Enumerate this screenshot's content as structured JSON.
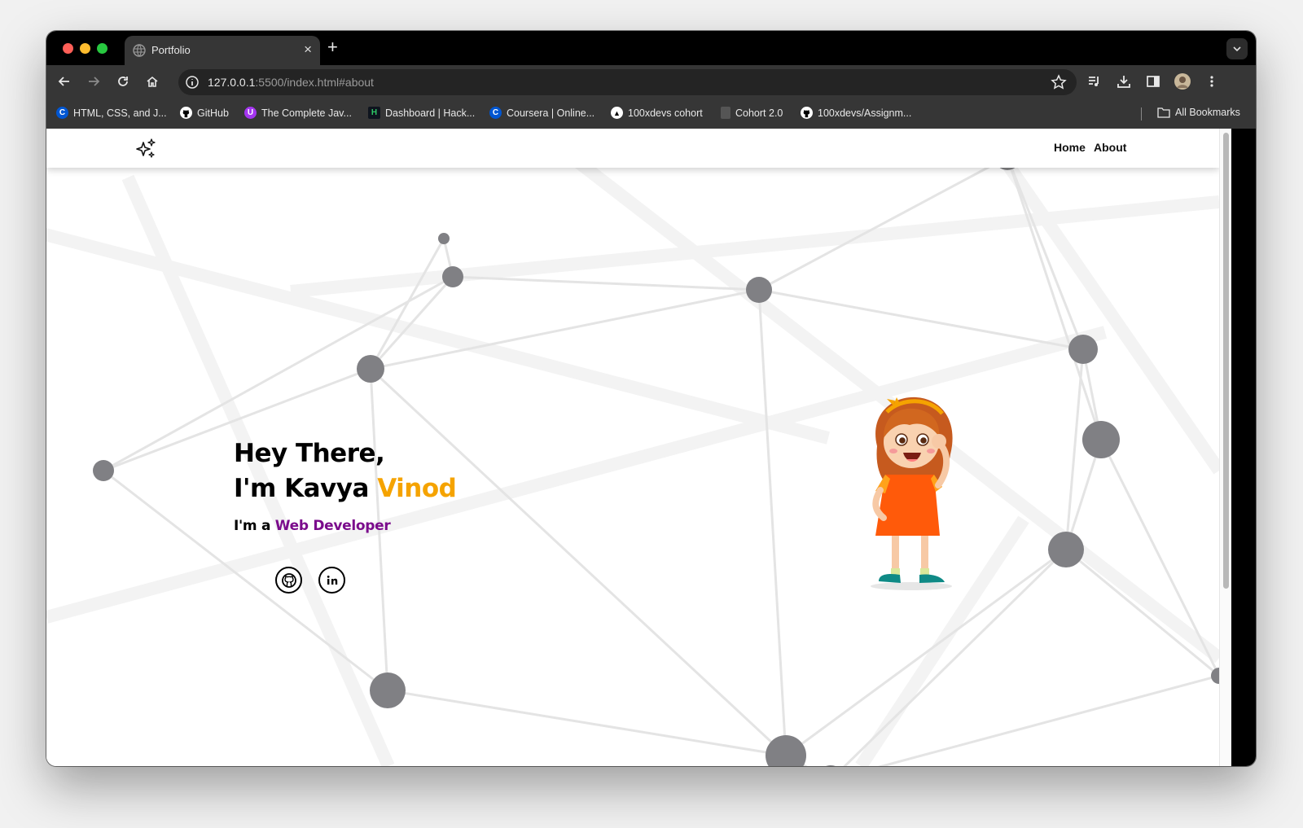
{
  "browser": {
    "tab": {
      "title": "Portfolio",
      "close": "×"
    },
    "new_tab": "+",
    "omnibox": {
      "host": "127.0.0.1",
      "rest": ":5500/index.html#about"
    },
    "bookmarks": [
      {
        "label": "HTML, CSS, and J...",
        "icon": "coursera-icon",
        "color": "#0056d2",
        "glyph": "C"
      },
      {
        "label": "GitHub",
        "icon": "github-icon",
        "color": "#000000",
        "glyph": ""
      },
      {
        "label": "The Complete Jav...",
        "icon": "udemy-icon",
        "color": "#a435f0",
        "glyph": "U"
      },
      {
        "label": "Dashboard | Hack...",
        "icon": "hackerrank-icon",
        "color": "#0e141e",
        "glyph": "H"
      },
      {
        "label": "Coursera | Online...",
        "icon": "coursera-icon",
        "color": "#0056d2",
        "glyph": "C"
      },
      {
        "label": "100xdevs cohort",
        "icon": "triangle-icon",
        "color": "#000000",
        "glyph": "▲"
      },
      {
        "label": "Cohort 2.0",
        "icon": "page-icon",
        "color": "#555555",
        "glyph": ""
      },
      {
        "label": "100xdevs/Assignm...",
        "icon": "github-icon",
        "color": "#000000",
        "glyph": ""
      }
    ],
    "all_bookmarks": "All Bookmarks"
  },
  "site": {
    "nav": {
      "home": "Home",
      "about": "About"
    },
    "hero": {
      "line1": "Hey There,",
      "line2_prefix": "I'm Kavya ",
      "line2_accent": "Vinod",
      "role_prefix": "I'm a ",
      "role_accent": "Web Developer"
    },
    "socials": [
      "github-icon",
      "linkedin-icon"
    ],
    "colors": {
      "accent_orange": "#f5a300",
      "accent_purple": "#7b0c8c"
    }
  }
}
